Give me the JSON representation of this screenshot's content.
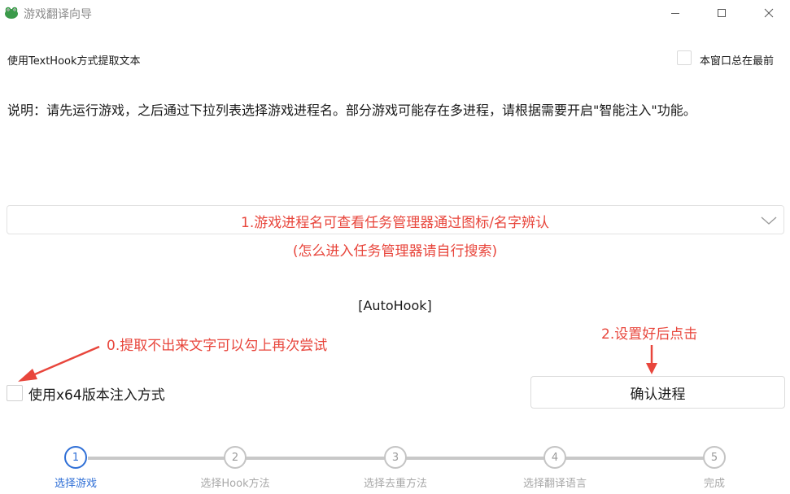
{
  "window": {
    "title": "游戏翻译向导",
    "logo_icon": "frog-icon",
    "controls": [
      "minimize-icon",
      "maximize-icon",
      "close-icon"
    ]
  },
  "header": {
    "mode_label": "使用TextHook方式提取文本",
    "always_on_top_label": "本窗口总在最前",
    "always_on_top_checked": false
  },
  "description": "说明：请先运行游戏，之后通过下拉列表选择游戏进程名。部分游戏可能存在多进程，请根据需要开启\"智能注入\"功能。",
  "process_select": {
    "value": "",
    "arrow_icon": "chevron-down-icon"
  },
  "annotations": {
    "step1_line1": "1.游戏进程名可查看任务管理器通过图标/名字辨认",
    "step1_line2": "(怎么进入任务管理器请自行搜索)",
    "step0": "0.提取不出来文字可以勾上再次尝试",
    "step2": "2.设置好后点击",
    "color": "#e8463c"
  },
  "autohook_label": "[AutoHook]",
  "x64_option": {
    "label": "使用x64版本注入方式",
    "checked": false
  },
  "confirm_button": "确认进程",
  "stepper": {
    "active_index": 0,
    "accent": "#2f6fd6",
    "steps": [
      {
        "number": "1",
        "label": "选择游戏"
      },
      {
        "number": "2",
        "label": "选择Hook方法"
      },
      {
        "number": "3",
        "label": "选择去重方法"
      },
      {
        "number": "4",
        "label": "选择翻译语言"
      },
      {
        "number": "5",
        "label": "完成"
      }
    ]
  }
}
